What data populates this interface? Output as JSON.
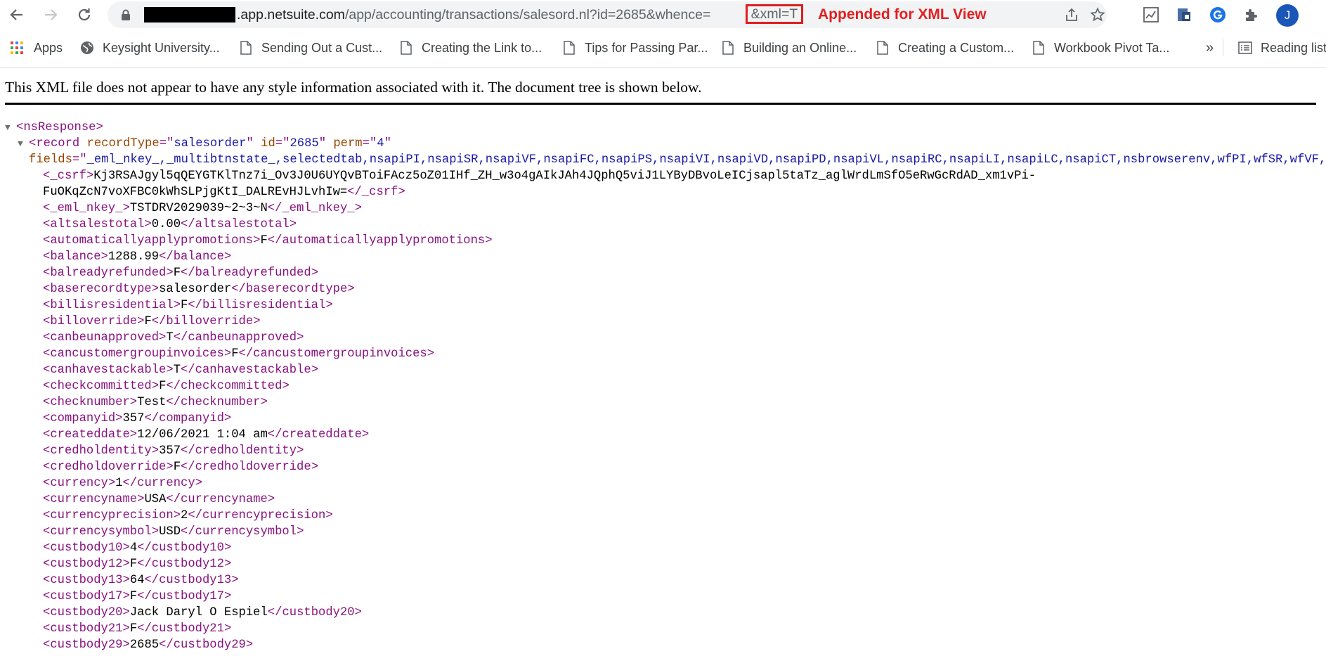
{
  "browser": {
    "url_host": ".app.netsuite.com",
    "url_path": "/app/accounting/transactions/salesord.nl?id=2685&whence=",
    "url_highlight": "&xml=T",
    "annotation": "Appended for XML View",
    "avatar_letter": "J",
    "bookmarks": [
      "Apps",
      "Keysight University...",
      "Sending Out a Cust...",
      "Creating the Link to...",
      "Tips for Passing Par...",
      "Building an Online...",
      "Creating a Custom...",
      "Workbook Pivot Ta..."
    ],
    "more": "»",
    "reading_list": "Reading list",
    "colors": {
      "annotation": "#e02020",
      "avatar": "#1a56b8"
    }
  },
  "page": {
    "notice": "This XML file does not appear to have any style information associated with it. The document tree is shown below.",
    "root_tag": "nsResponse",
    "record": {
      "tag": "record",
      "attrs": [
        {
          "name": "recordType",
          "value": "salesorder"
        },
        {
          "name": "id",
          "value": "2685"
        },
        {
          "name": "perm",
          "value": "4"
        }
      ],
      "fields_attr": "fields",
      "fields_value": "_eml_nkey_,_multibtnstate_,selectedtab,nsapiPI,nsapiSR,nsapiVF,nsapiFC,nsapiPS,nsapiVI,nsapiVD,nsapiPD,nsapiVL,nsapiRC,nsapiLI,nsapiLC,nsapiCT,nsbrowserenv,wfPI,wfSR,wfVF,"
    },
    "csrf": {
      "tag": "_csrf",
      "line1": "Kj3RSAJgyl5qQEYGTKlTnz7i_Ov3J0U6UYQvBToiFAcz5oZ01IHf_ZH_w3o4gAIkJAh4JQphQ5viJ1LYByDBvoLeICjsapl5taTz_aglWrdLmSfO5eRwGcRdAD_xm1vPi-",
      "line2": "FuOKqZcN7voXFBC0kWhSLPjgKtI_DALREvHJLvhIw="
    },
    "elements": [
      {
        "tag": "_eml_nkey_",
        "value": "TSTDRV2029039~2~3~N"
      },
      {
        "tag": "altsalestotal",
        "value": "0.00"
      },
      {
        "tag": "automaticallyapplypromotions",
        "value": "F"
      },
      {
        "tag": "balance",
        "value": "1288.99"
      },
      {
        "tag": "balreadyrefunded",
        "value": "F"
      },
      {
        "tag": "baserecordtype",
        "value": "salesorder"
      },
      {
        "tag": "billisresidential",
        "value": "F"
      },
      {
        "tag": "billoverride",
        "value": "F"
      },
      {
        "tag": "canbeunapproved",
        "value": "T"
      },
      {
        "tag": "cancustomergroupinvoices",
        "value": "F"
      },
      {
        "tag": "canhavestackable",
        "value": "T"
      },
      {
        "tag": "checkcommitted",
        "value": "F"
      },
      {
        "tag": "checknumber",
        "value": "Test"
      },
      {
        "tag": "companyid",
        "value": "357"
      },
      {
        "tag": "createddate",
        "value": "12/06/2021 1:04 am"
      },
      {
        "tag": "credholdentity",
        "value": "357"
      },
      {
        "tag": "credholdoverride",
        "value": "F"
      },
      {
        "tag": "currency",
        "value": "1"
      },
      {
        "tag": "currencyname",
        "value": "USA"
      },
      {
        "tag": "currencyprecision",
        "value": "2"
      },
      {
        "tag": "currencysymbol",
        "value": "USD"
      },
      {
        "tag": "custbody10",
        "value": "4"
      },
      {
        "tag": "custbody12",
        "value": "F"
      },
      {
        "tag": "custbody13",
        "value": "64"
      },
      {
        "tag": "custbody17",
        "value": "F"
      },
      {
        "tag": "custbody20",
        "value": "Jack Daryl O Espiel"
      },
      {
        "tag": "custbody21",
        "value": "F"
      },
      {
        "tag": "custbody29",
        "value": "2685"
      }
    ]
  }
}
